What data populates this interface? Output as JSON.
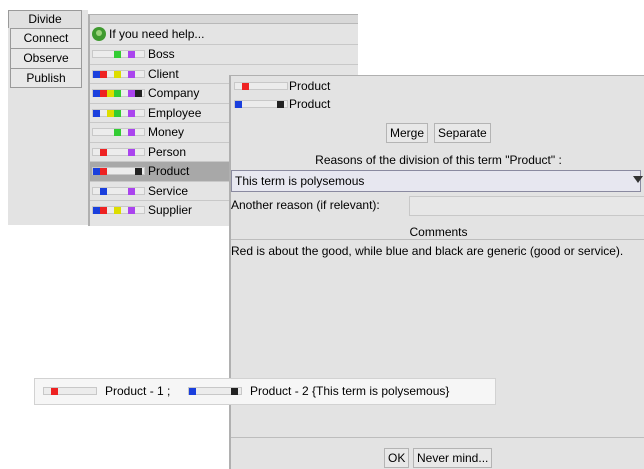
{
  "tabs": [
    "Divide",
    "Connect",
    "Observe",
    "Publish"
  ],
  "help_text": "If you need help...",
  "terms": [
    {
      "label": "Boss",
      "colors": [
        "#33cc33",
        "#aa44ee"
      ],
      "slots": [
        3,
        5
      ]
    },
    {
      "label": "Client",
      "colors": [
        "#1a3fdd",
        "#ee2222",
        "#dddd00",
        "#aa44ee"
      ],
      "slots": [
        0,
        1,
        3,
        5
      ]
    },
    {
      "label": "Company",
      "colors": [
        "#1a3fdd",
        "#ee2222",
        "#dddd00",
        "#33cc33",
        "#aa44ee",
        "#222222"
      ],
      "slots": [
        0,
        1,
        2,
        3,
        5,
        6
      ]
    },
    {
      "label": "Employee",
      "colors": [
        "#1a3fdd",
        "#dddd00",
        "#33cc33",
        "#aa44ee"
      ],
      "slots": [
        0,
        2,
        3,
        5
      ]
    },
    {
      "label": "Money",
      "colors": [
        "#33cc33",
        "#aa44ee"
      ],
      "slots": [
        3,
        5
      ]
    },
    {
      "label": "Person",
      "colors": [
        "#ee2222",
        "#aa44ee"
      ],
      "slots": [
        1,
        5
      ]
    },
    {
      "label": "Product",
      "colors": [
        "#1a3fdd",
        "#ee2222",
        "#222222"
      ],
      "slots": [
        0,
        1,
        6
      ],
      "selected": true
    },
    {
      "label": "Service",
      "colors": [
        "#1a3fdd",
        "#aa44ee"
      ],
      "slots": [
        1,
        5
      ]
    },
    {
      "label": "Supplier",
      "colors": [
        "#1a3fdd",
        "#ee2222",
        "#dddd00",
        "#aa44ee"
      ],
      "slots": [
        0,
        1,
        3,
        5
      ]
    }
  ],
  "dialog": {
    "term_a": {
      "label": "Product",
      "colors": [
        "#ee2222"
      ],
      "slots": [
        1
      ]
    },
    "term_b": {
      "label": "Product",
      "colors": [
        "#1a3fdd",
        "#222222"
      ],
      "slots": [
        0,
        6
      ]
    },
    "merge_label": "Merge",
    "separate_label": "Separate",
    "reasons_label": "Reasons of the division of this term \"Product\" :",
    "reason_value": "This term is polysemous",
    "another_reason_label": "Another reason (if relevant):",
    "another_reason_value": "",
    "comments_label": "Comments",
    "comments_text": "Red is about the good, while blue and black are generic (good or service).",
    "ok_label": "OK",
    "cancel_label": "Never mind..."
  },
  "result": {
    "part1": "Product - 1 ;",
    "part2": "Product - 2 {This term is polysemous}"
  }
}
